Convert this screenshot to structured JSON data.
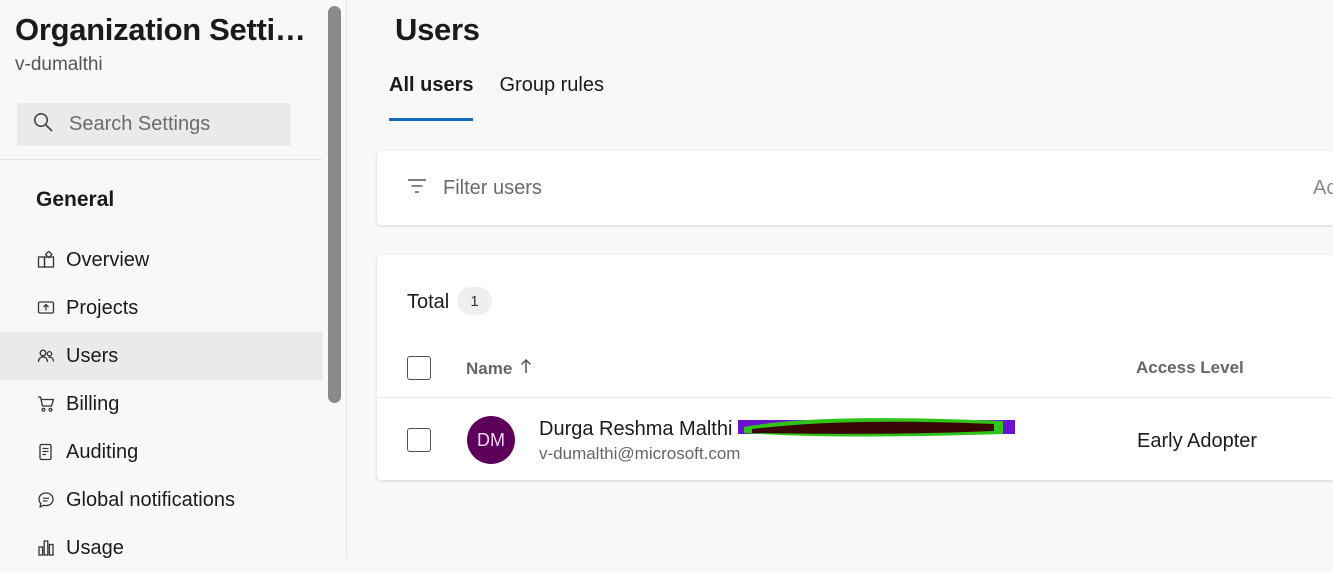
{
  "sidebar": {
    "org_title": "Organization Settin...",
    "org_subtitle": "v-dumalthi",
    "search": {
      "placeholder": "Search Settings",
      "icon": "search-icon"
    },
    "section_title": "General",
    "items": [
      {
        "label": "Overview",
        "icon": "overview-icon",
        "active": false
      },
      {
        "label": "Projects",
        "icon": "projects-icon",
        "active": false
      },
      {
        "label": "Users",
        "icon": "users-icon",
        "active": true
      },
      {
        "label": "Billing",
        "icon": "cart-icon",
        "active": false
      },
      {
        "label": "Auditing",
        "icon": "auditing-icon",
        "active": false
      },
      {
        "label": "Global notifications",
        "icon": "notifications-icon",
        "active": false
      },
      {
        "label": "Usage",
        "icon": "usage-icon",
        "active": false
      }
    ]
  },
  "main": {
    "title": "Users",
    "tabs": [
      {
        "label": "All users",
        "active": true
      },
      {
        "label": "Group rules",
        "active": false
      }
    ],
    "filter": {
      "placeholder": "Filter users",
      "icon": "filter-icon",
      "right_text": "Ac"
    },
    "table": {
      "total_label": "Total",
      "total_count": "1",
      "columns": {
        "name": "Name",
        "sort_icon": "arrow-up-icon",
        "access": "Access Level"
      },
      "rows": [
        {
          "initials": "DM",
          "name": "Durga Reshma Malthi",
          "email": "v-dumalthi@microsoft.com",
          "access": "Early Adopter"
        }
      ]
    }
  },
  "colors": {
    "accent": "#0f6cbd",
    "avatar_bg": "#5c005c",
    "active_nav_bg": "#eaeaea"
  }
}
